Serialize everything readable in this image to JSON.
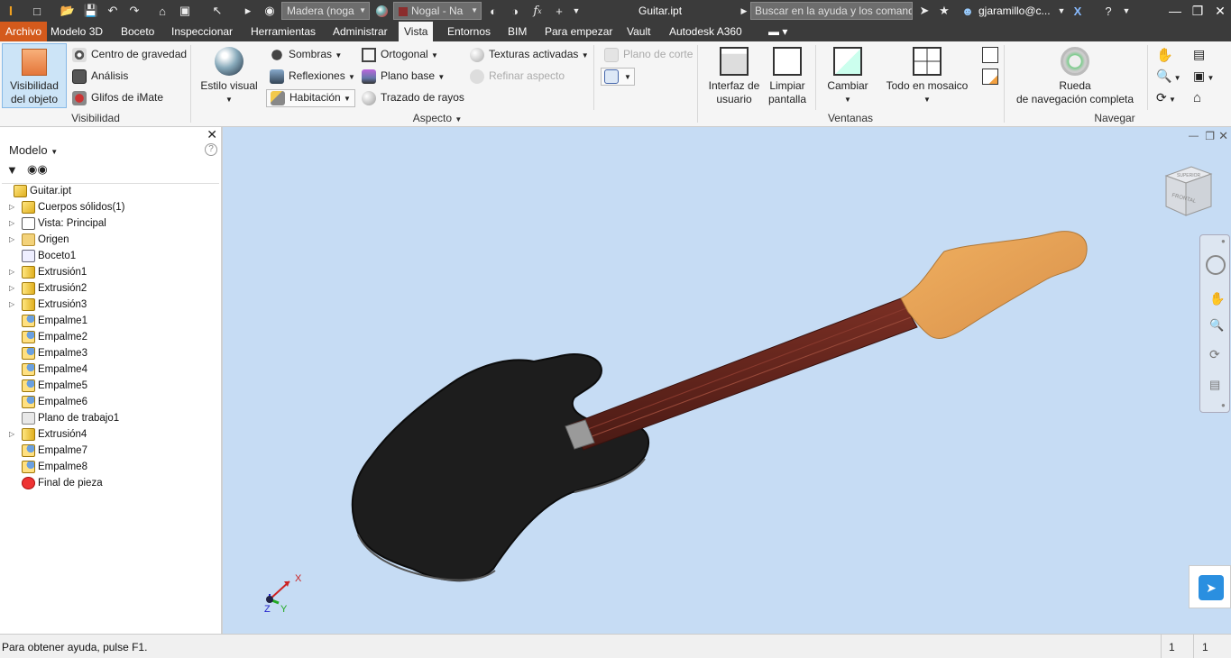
{
  "titlebar": {
    "material_dropdown": "Madera (noga",
    "appearance_dropdown": "Nogal - Na",
    "document_title": "Guitar.ipt",
    "search_placeholder": "Buscar en la ayuda y los comandos...",
    "search_value": "Buscar en la ayuda y los comand",
    "user": "gjaramillo@c..."
  },
  "tabs": [
    "Archivo",
    "Modelo 3D",
    "Boceto",
    "Inspeccionar",
    "Herramientas",
    "Administrar",
    "Vista",
    "Entornos",
    "BIM",
    "Para empezar",
    "Vault",
    "Autodesk A360"
  ],
  "active_tab": "Vista",
  "ribbon": {
    "visibilidad": {
      "object_visibility_l1": "Visibilidad",
      "object_visibility_l2": "del objeto",
      "center_of_gravity": "Centro de gravedad",
      "analysis": "Análisis",
      "imate_glyphs": "Glifos de iMate",
      "label": "Visibilidad"
    },
    "aspecto": {
      "visual_style": "Estilo visual",
      "shadows": "Sombras",
      "reflections": "Reflexiones",
      "room": "Habitación",
      "orthographic": "Ortogonal",
      "ground_plane": "Plano base",
      "ray_tracing": "Trazado de rayos",
      "textures_on": "Texturas activadas",
      "refine_appearance": "Refinar aspecto",
      "section_plane": "Plano de corte",
      "label": "Aspecto"
    },
    "ventanas": {
      "user_interface_l1": "Interfaz de",
      "user_interface_l2": "usuario",
      "clean_screen_l1": "Limpiar",
      "clean_screen_l2": "pantalla",
      "switch": "Cambiar",
      "tile_all": "Todo en mosaico",
      "label": "Ventanas"
    },
    "navegar": {
      "full_nav_wheel_l1": "Rueda",
      "full_nav_wheel_l2": "de navegación completa",
      "label": "Navegar"
    }
  },
  "browser": {
    "title": "Modelo",
    "items": [
      {
        "label": "Guitar.ipt",
        "icon": "part-icon",
        "expandable": false
      },
      {
        "label": "Cuerpos sólidos(1)",
        "icon": "solid-bodies-icon",
        "expandable": true
      },
      {
        "label": "Vista: Principal",
        "icon": "view-icon",
        "expandable": true
      },
      {
        "label": "Origen",
        "icon": "folder-icon",
        "expandable": true
      },
      {
        "label": "Boceto1",
        "icon": "sketch-icon",
        "expandable": false
      },
      {
        "label": "Extrusión1",
        "icon": "extrude-icon",
        "expandable": true
      },
      {
        "label": "Extrusión2",
        "icon": "extrude-icon",
        "expandable": true
      },
      {
        "label": "Extrusión3",
        "icon": "extrude-icon",
        "expandable": true
      },
      {
        "label": "Empalme1",
        "icon": "fillet-icon",
        "expandable": false
      },
      {
        "label": "Empalme2",
        "icon": "fillet-icon",
        "expandable": false
      },
      {
        "label": "Empalme3",
        "icon": "fillet-icon",
        "expandable": false
      },
      {
        "label": "Empalme4",
        "icon": "fillet-icon",
        "expandable": false
      },
      {
        "label": "Empalme5",
        "icon": "fillet-icon",
        "expandable": false
      },
      {
        "label": "Empalme6",
        "icon": "fillet-icon",
        "expandable": false
      },
      {
        "label": "Plano de trabajo1",
        "icon": "work-plane-icon",
        "expandable": false
      },
      {
        "label": "Extrusión4",
        "icon": "extrude-icon",
        "expandable": true
      },
      {
        "label": "Empalme7",
        "icon": "fillet-icon",
        "expandable": false
      },
      {
        "label": "Empalme8",
        "icon": "fillet-icon",
        "expandable": false
      },
      {
        "label": "Final de pieza",
        "icon": "end-of-part-icon",
        "expandable": false
      }
    ]
  },
  "viewcube": {
    "front": "FRONTAL",
    "top": "SUPERIOR"
  },
  "triad": {
    "x": "X",
    "y": "Y",
    "z": "Z"
  },
  "status": {
    "help": "Para obtener ayuda, pulse F1.",
    "count1": "1",
    "count2": "1"
  },
  "colors": {
    "accent_orange": "#d45a1c",
    "viewport_bg": "#c6dcf4",
    "title_bg": "#3b3b3b",
    "selection_blue": "#cce4f7"
  }
}
